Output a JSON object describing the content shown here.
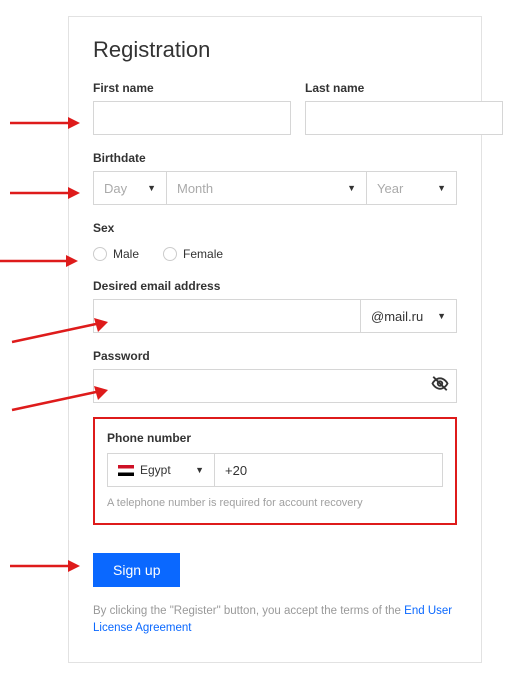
{
  "title": "Registration",
  "firstName": {
    "label": "First name"
  },
  "lastName": {
    "label": "Last name"
  },
  "birthdate": {
    "label": "Birthdate",
    "day": "Day",
    "month": "Month",
    "year": "Year"
  },
  "sex": {
    "label": "Sex",
    "male": "Male",
    "female": "Female"
  },
  "email": {
    "label": "Desired email address",
    "domain": "@mail.ru"
  },
  "password": {
    "label": "Password"
  },
  "phone": {
    "label": "Phone number",
    "country": "Egypt",
    "code": "+20",
    "hint": "A telephone number is required for account recovery"
  },
  "signup": "Sign up",
  "terms": {
    "prefix": "By clicking the \"Register\" button, you accept the terms of the ",
    "link": "End User License Agreement"
  }
}
